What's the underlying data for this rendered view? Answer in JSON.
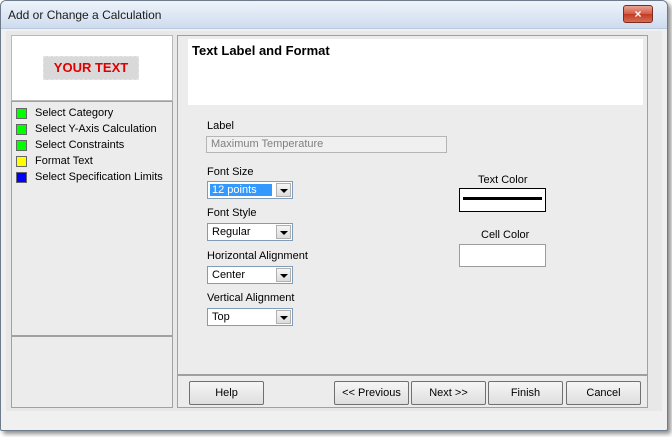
{
  "window": {
    "title": "Add or Change a Calculation",
    "close_glyph": "×"
  },
  "preview": {
    "text": "YOUR TEXT"
  },
  "steps": [
    {
      "label": "Select Category",
      "status_color": "#00ff00"
    },
    {
      "label": "Select Y-Axis Calculation",
      "status_color": "#00ff00"
    },
    {
      "label": "Select Constraints",
      "status_color": "#00ff00"
    },
    {
      "label": "Format Text",
      "status_color": "#ffff00"
    },
    {
      "label": "Select Specification Limits",
      "status_color": "#0000ff"
    }
  ],
  "panel": {
    "title": "Text Label and Format",
    "label_caption": "Label",
    "label_value": "Maximum Temperature",
    "font_size": {
      "caption": "Font Size",
      "value": "12 points"
    },
    "font_style": {
      "caption": "Font Style",
      "value": "Regular"
    },
    "horizontal_alignment": {
      "caption": "Horizontal Alignment",
      "value": "Center"
    },
    "vertical_alignment": {
      "caption": "Vertical Alignment",
      "value": "Top"
    },
    "text_color": {
      "caption": "Text Color",
      "color": "#000000"
    },
    "cell_color": {
      "caption": "Cell Color",
      "color": "#ffffff"
    }
  },
  "buttons": {
    "help": "Help",
    "previous": "<< Previous",
    "next": "Next >>",
    "finish": "Finish",
    "cancel": "Cancel"
  },
  "colors": {
    "title_bar": "#dbe6f4",
    "preview_text": "#e00000",
    "selection": "#3399ff"
  }
}
